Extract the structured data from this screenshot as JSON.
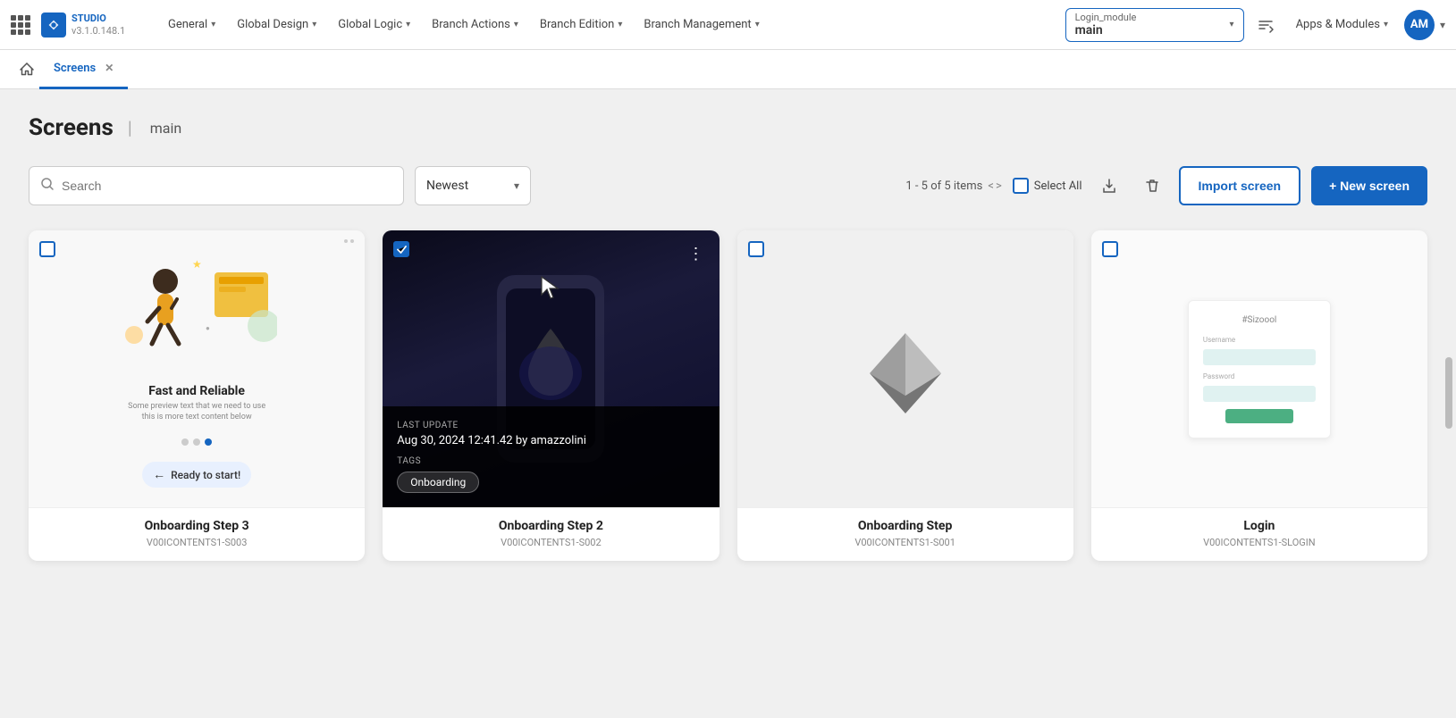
{
  "app": {
    "name": "STUDIO",
    "version": "v3.1.0.148.1"
  },
  "nav": {
    "items": [
      {
        "id": "general",
        "label": "General",
        "hasChevron": true
      },
      {
        "id": "global-design",
        "label": "Global Design",
        "hasChevron": true
      },
      {
        "id": "global-logic",
        "label": "Global Logic",
        "hasChevron": true
      },
      {
        "id": "branch-actions",
        "label": "Branch Actions",
        "hasChevron": true
      },
      {
        "id": "branch-edition",
        "label": "Branch Edition",
        "hasChevron": true
      },
      {
        "id": "branch-management",
        "label": "Branch Management",
        "hasChevron": true
      }
    ],
    "module": "Login_module",
    "branch": "main",
    "apps_modules": "Apps & Modules",
    "avatar": "AM"
  },
  "tabs": [
    {
      "id": "home",
      "label": "Home",
      "isHome": true
    },
    {
      "id": "screens",
      "label": "Screens",
      "active": true,
      "closable": true
    }
  ],
  "page": {
    "title": "Screens",
    "branch": "main"
  },
  "toolbar": {
    "search_placeholder": "Search",
    "sort_label": "Newest",
    "pagination": "1 - 5 of 5 items",
    "select_all": "Select All",
    "import_label": "Import screen",
    "new_label": "+ New screen"
  },
  "screens": [
    {
      "id": "onboarding-step-3",
      "name": "Onboarding Step 3",
      "code": "V00ICONTENTS1-S003",
      "type": "light",
      "tags": [],
      "selected": false,
      "last_update": ""
    },
    {
      "id": "onboarding-step-2",
      "name": "Onboarding Step 2",
      "code": "V00ICONTENTS1-S002",
      "type": "dark",
      "tags": [
        "Onboarding"
      ],
      "selected": true,
      "last_update": "Aug 30, 2024 12:41.42 by amazzolini"
    },
    {
      "id": "onboarding-step",
      "name": "Onboarding Step",
      "code": "V00ICONTENTS1-S001",
      "type": "gray",
      "tags": [],
      "selected": false,
      "last_update": ""
    },
    {
      "id": "login",
      "name": "Login",
      "code": "V00ICONTENTS1-SLOGIN",
      "type": "white",
      "tags": [],
      "selected": false,
      "last_update": ""
    }
  ]
}
